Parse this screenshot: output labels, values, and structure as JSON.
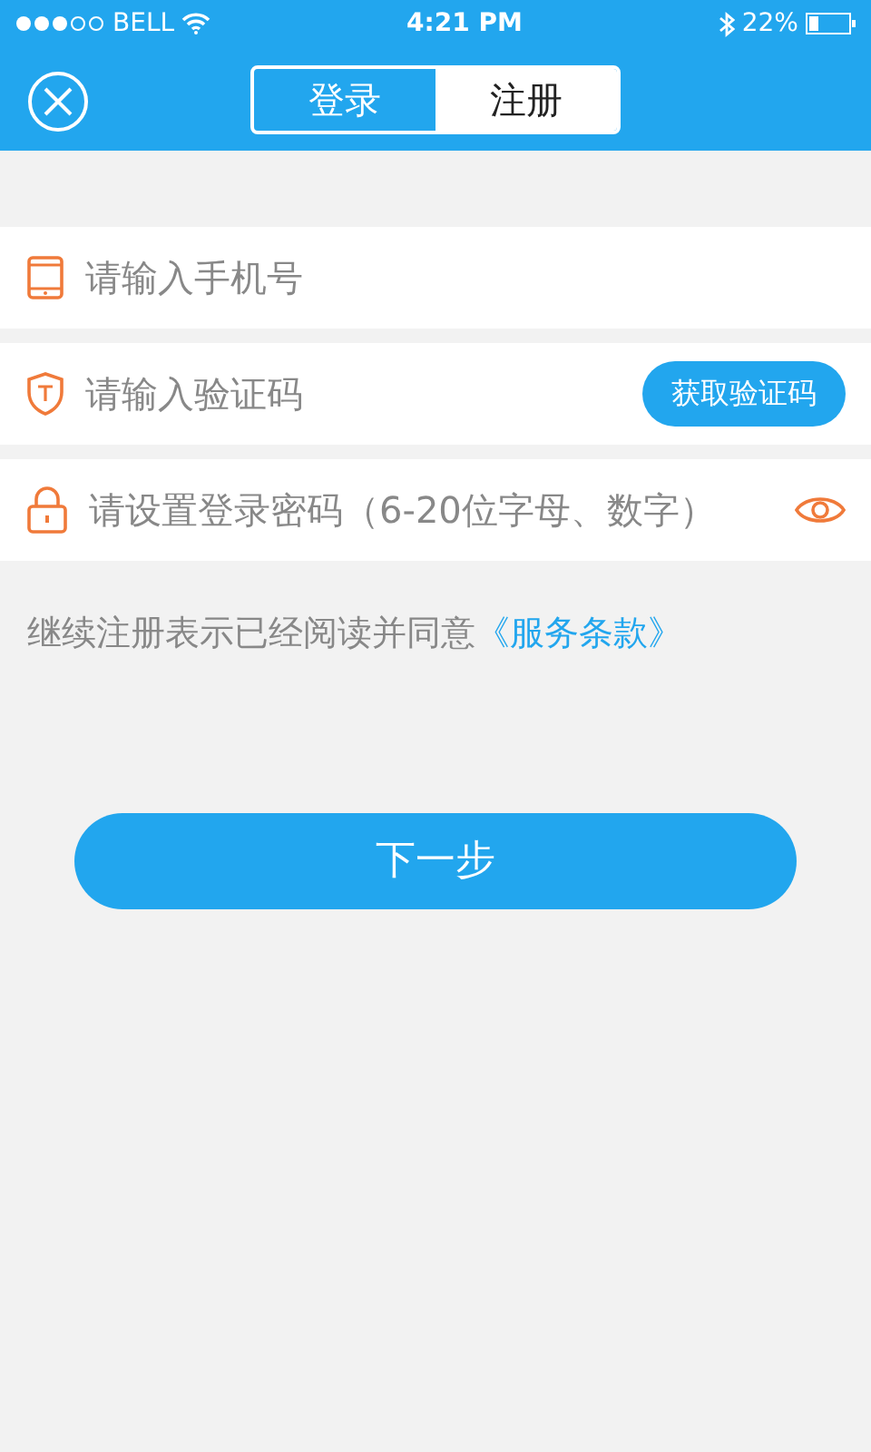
{
  "status_bar": {
    "carrier": "BELL",
    "time": "4:21 PM",
    "battery": "22%"
  },
  "tabs": [
    {
      "label": "登录",
      "selected": false
    },
    {
      "label": "注册",
      "selected": true
    }
  ],
  "fields": [
    {
      "kind": "phone",
      "placeholder": "请输入手机号"
    },
    {
      "kind": "code",
      "placeholder": "请输入验证码",
      "button": "获取验证码"
    },
    {
      "kind": "password",
      "placeholder": "请设置登录密码（6-20位字母、数字）"
    }
  ],
  "terms": {
    "text": "继续注册表示已经阅读并同意",
    "link": "《服务条款》"
  },
  "next_button": "下一步"
}
